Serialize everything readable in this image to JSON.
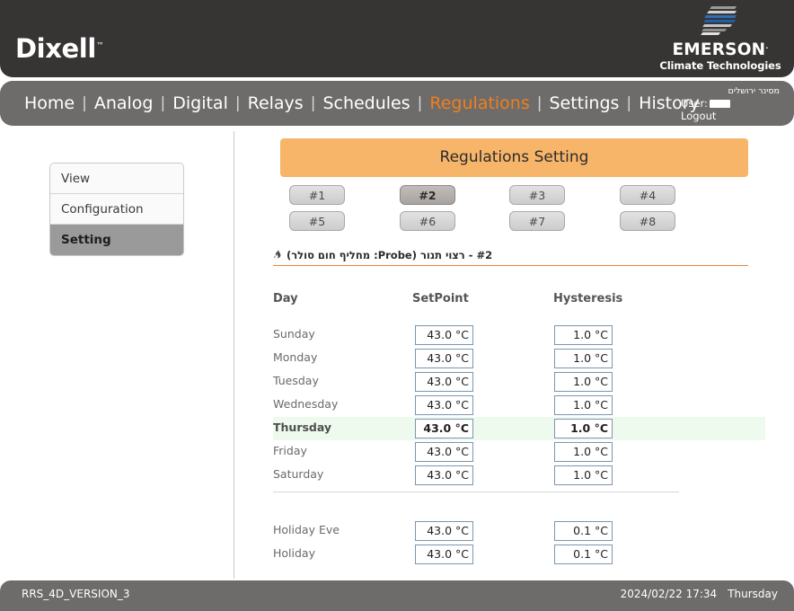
{
  "header": {
    "brand": "Dixell",
    "brand_tm": "™",
    "partner_name": "EMERSON",
    "partner_tm": ".",
    "partner_sub": "Climate Technologies",
    "logo_colors": [
      "#8a8a8a",
      "#c9c9c9",
      "#2f6fb5",
      "#1f5ea8",
      "#bdbdbd",
      "#8f8f8f",
      "#dedede"
    ]
  },
  "nav": {
    "items": [
      {
        "label": "Home",
        "active": false
      },
      {
        "label": "Analog",
        "active": false
      },
      {
        "label": "Digital",
        "active": false
      },
      {
        "label": "Relays",
        "active": false
      },
      {
        "label": "Schedules",
        "active": false
      },
      {
        "label": "Regulations",
        "active": true
      },
      {
        "label": "Settings",
        "active": false
      },
      {
        "label": "History",
        "active": false
      }
    ],
    "separator": "|",
    "active_color": "#ee7f1c",
    "site_name": "מסינר ירושלים",
    "user_label": "User:",
    "user_value": "",
    "logout_label": "Logout"
  },
  "sidebar": {
    "items": [
      {
        "label": "View",
        "active": false
      },
      {
        "label": "Configuration",
        "active": false
      },
      {
        "label": "Setting",
        "active": true
      }
    ]
  },
  "main": {
    "panel_title": "Regulations Setting",
    "panel_title_color": "#f7b569",
    "regulation_buttons": [
      {
        "label": "#1",
        "active": false
      },
      {
        "label": "#2",
        "active": true
      },
      {
        "label": "#3",
        "active": false
      },
      {
        "label": "#4",
        "active": false
      },
      {
        "label": "#5",
        "active": false
      },
      {
        "label": "#6",
        "active": false
      },
      {
        "label": "#7",
        "active": false
      },
      {
        "label": "#8",
        "active": false
      }
    ],
    "probe_line": "#2 - רצוי תנור (Probe: מחליף חום סולר)",
    "probe_icon": "flame-icon",
    "table": {
      "columns": [
        "Day",
        "SetPoint",
        "Hysteresis"
      ],
      "rows": [
        {
          "day": "Sunday",
          "setpoint": "43.0 °C",
          "hysteresis": "1.0 °C",
          "highlight": false
        },
        {
          "day": "Monday",
          "setpoint": "43.0 °C",
          "hysteresis": "1.0 °C",
          "highlight": false
        },
        {
          "day": "Tuesday",
          "setpoint": "43.0 °C",
          "hysteresis": "1.0 °C",
          "highlight": false
        },
        {
          "day": "Wednesday",
          "setpoint": "43.0 °C",
          "hysteresis": "1.0 °C",
          "highlight": false
        },
        {
          "day": "Thursday",
          "setpoint": "43.0 °C",
          "hysteresis": "1.0 °C",
          "highlight": true
        },
        {
          "day": "Friday",
          "setpoint": "43.0 °C",
          "hysteresis": "1.0 °C",
          "highlight": false
        },
        {
          "day": "Saturday",
          "setpoint": "43.0 °C",
          "hysteresis": "1.0 °C",
          "highlight": false
        }
      ],
      "extra_rows": [
        {
          "day": "Holiday Eve",
          "setpoint": "43.0 °C",
          "hysteresis": "0.1 °C",
          "highlight": false
        },
        {
          "day": "Holiday",
          "setpoint": "43.0 °C",
          "hysteresis": "0.1 °C",
          "highlight": false
        }
      ],
      "highlight_color": "#effaef"
    }
  },
  "footer": {
    "version": "RRS_4D_VERSION_3",
    "datetime": "2024/02/22 17:34",
    "weekday": "Thursday"
  }
}
